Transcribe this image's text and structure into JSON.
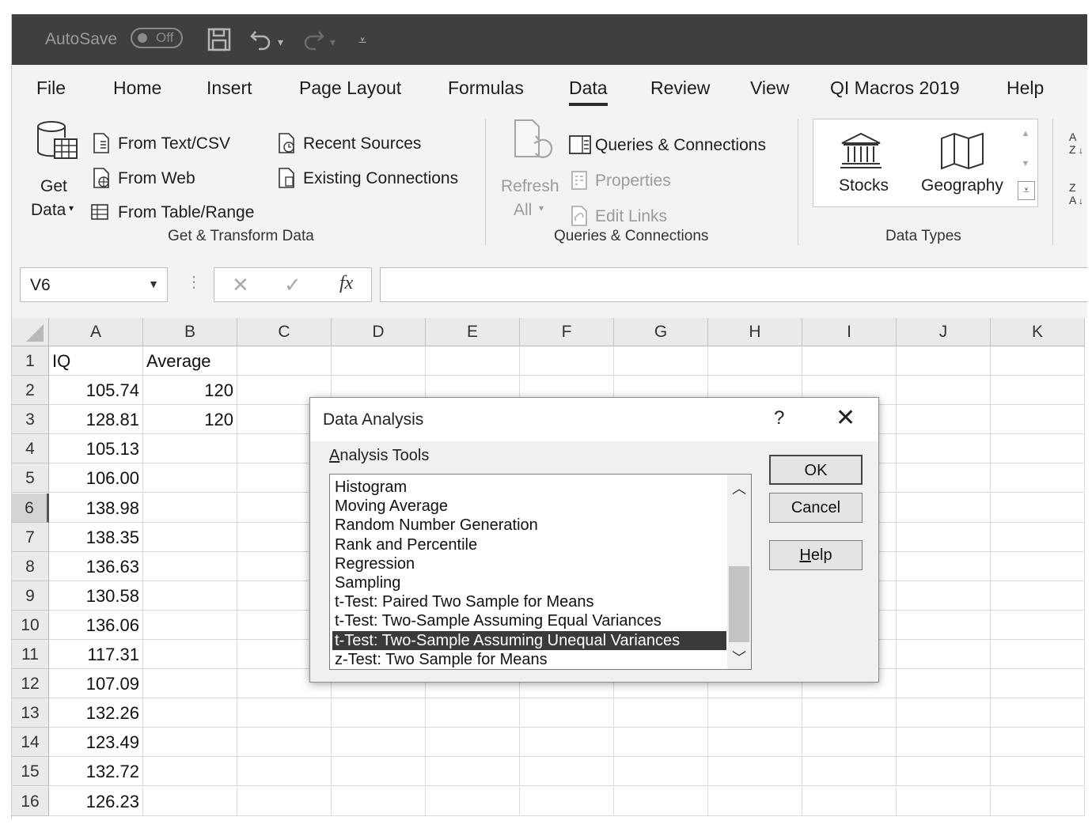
{
  "titlebar": {
    "autosave_label": "AutoSave",
    "autosave_state": "Off"
  },
  "tabs": [
    "File",
    "Home",
    "Insert",
    "Page Layout",
    "Formulas",
    "Data",
    "Review",
    "View",
    "QI Macros 2019",
    "Help"
  ],
  "active_tab": "Data",
  "ribbon": {
    "get_transform": {
      "get_data_line1": "Get",
      "get_data_line2": "Data",
      "from_text_csv": "From Text/CSV",
      "from_web": "From Web",
      "from_table_range": "From Table/Range",
      "recent_sources": "Recent Sources",
      "existing_connections": "Existing Connections",
      "group_label": "Get & Transform Data"
    },
    "queries": {
      "refresh_line1": "Refresh",
      "refresh_line2": "All",
      "queries_connections": "Queries & Connections",
      "properties": "Properties",
      "edit_links": "Edit Links",
      "group_label": "Queries & Connections"
    },
    "data_types": {
      "stocks": "Stocks",
      "geography": "Geography",
      "group_label": "Data Types"
    }
  },
  "formula_bar": {
    "name_box": "V6",
    "fx": "fx",
    "formula": ""
  },
  "sheet": {
    "columns": [
      "A",
      "B",
      "C",
      "D",
      "E",
      "F",
      "G",
      "H",
      "I",
      "J",
      "K"
    ],
    "rows": [
      "1",
      "2",
      "3",
      "4",
      "5",
      "6",
      "7",
      "8",
      "9",
      "10",
      "11",
      "12",
      "13",
      "14",
      "15",
      "16"
    ],
    "selected_row": "6",
    "col_a": [
      "IQ",
      "105.74",
      "128.81",
      "105.13",
      "106.00",
      "138.98",
      "138.35",
      "136.63",
      "130.58",
      "136.06",
      "117.31",
      "107.09",
      "132.26",
      "123.49",
      "132.72",
      "126.23"
    ],
    "col_b": [
      "Average",
      "120",
      "120",
      "",
      "",
      "",
      "",
      "",
      "",
      "",
      "",
      "",
      "",
      "",
      "",
      ""
    ]
  },
  "dialog": {
    "title": "Data Analysis",
    "help_symbol": "?",
    "list_label": "Analysis Tools",
    "tools": [
      "Histogram",
      "Moving Average",
      "Random Number Generation",
      "Rank and Percentile",
      "Regression",
      "Sampling",
      "t-Test: Paired Two Sample for Means",
      "t-Test: Two-Sample Assuming Equal Variances",
      "t-Test: Two-Sample Assuming Unequal Variances",
      "z-Test: Two Sample for Means"
    ],
    "selected_tool": "t-Test: Two-Sample Assuming Unequal Variances",
    "ok_label": "OK",
    "cancel_label": "Cancel",
    "help_label": "Help"
  }
}
